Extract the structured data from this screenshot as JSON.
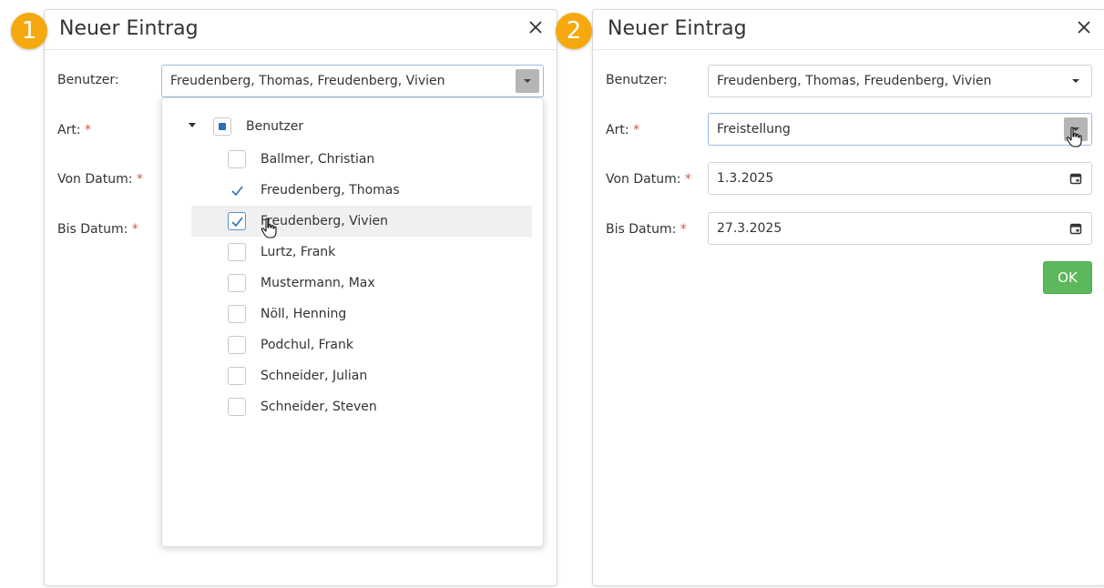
{
  "step1": {
    "badge": "1",
    "dialog_title": "Neuer Eintrag",
    "labels": {
      "benutzer": "Benutzer:",
      "art": "Art:",
      "von_datum": "Von Datum:",
      "bis_datum": "Bis Datum:",
      "required_mark": "*"
    },
    "benutzer_value": "Freudenberg, Thomas, Freudenberg, Vivien",
    "tree": {
      "root_label": "Benutzer",
      "root_state": "indeterminate",
      "items": [
        {
          "label": "Ballmer, Christian",
          "checked": false
        },
        {
          "label": "Freudenberg, Thomas",
          "checked": true
        },
        {
          "label": "Freudenberg, Vivien",
          "checked": true
        },
        {
          "label": "Lurtz, Frank",
          "checked": false
        },
        {
          "label": "Mustermann, Max",
          "checked": false
        },
        {
          "label": "Nöll, Henning",
          "checked": false
        },
        {
          "label": "Podchul, Frank",
          "checked": false
        },
        {
          "label": "Schneider, Julian",
          "checked": false
        },
        {
          "label": "Schneider, Steven",
          "checked": false
        }
      ]
    }
  },
  "step2": {
    "badge": "2",
    "dialog_title": "Neuer Eintrag",
    "labels": {
      "benutzer": "Benutzer:",
      "art": "Art:",
      "von_datum": "Von Datum:",
      "bis_datum": "Bis Datum:",
      "required_mark": "*"
    },
    "benutzer_value": "Freudenberg, Thomas, Freudenberg, Vivien",
    "art_value": "Freistellung",
    "von_datum_value": "1.3.2025",
    "bis_datum_value": "27.3.2025",
    "ok_label": "OK"
  },
  "colors": {
    "badge": "#f5a90f",
    "ok_button": "#5cb85c",
    "required": "#d9534f",
    "checkbox_check": "#2f6eb5"
  },
  "icons": [
    "close-icon",
    "chevron-down-icon",
    "calendar-icon",
    "check-icon",
    "hand-cursor-icon"
  ]
}
